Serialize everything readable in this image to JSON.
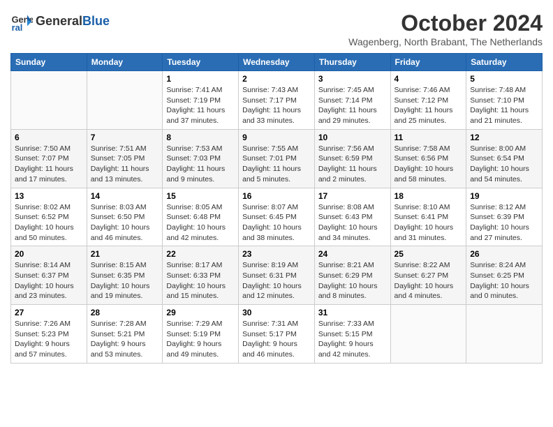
{
  "logo": {
    "line1": "General",
    "line2": "Blue"
  },
  "title": "October 2024",
  "location": "Wagenberg, North Brabant, The Netherlands",
  "weekdays": [
    "Sunday",
    "Monday",
    "Tuesday",
    "Wednesday",
    "Thursday",
    "Friday",
    "Saturday"
  ],
  "weeks": [
    [
      {
        "day": "",
        "info": ""
      },
      {
        "day": "",
        "info": ""
      },
      {
        "day": "1",
        "info": "Sunrise: 7:41 AM\nSunset: 7:19 PM\nDaylight: 11 hours and 37 minutes."
      },
      {
        "day": "2",
        "info": "Sunrise: 7:43 AM\nSunset: 7:17 PM\nDaylight: 11 hours and 33 minutes."
      },
      {
        "day": "3",
        "info": "Sunrise: 7:45 AM\nSunset: 7:14 PM\nDaylight: 11 hours and 29 minutes."
      },
      {
        "day": "4",
        "info": "Sunrise: 7:46 AM\nSunset: 7:12 PM\nDaylight: 11 hours and 25 minutes."
      },
      {
        "day": "5",
        "info": "Sunrise: 7:48 AM\nSunset: 7:10 PM\nDaylight: 11 hours and 21 minutes."
      }
    ],
    [
      {
        "day": "6",
        "info": "Sunrise: 7:50 AM\nSunset: 7:07 PM\nDaylight: 11 hours and 17 minutes."
      },
      {
        "day": "7",
        "info": "Sunrise: 7:51 AM\nSunset: 7:05 PM\nDaylight: 11 hours and 13 minutes."
      },
      {
        "day": "8",
        "info": "Sunrise: 7:53 AM\nSunset: 7:03 PM\nDaylight: 11 hours and 9 minutes."
      },
      {
        "day": "9",
        "info": "Sunrise: 7:55 AM\nSunset: 7:01 PM\nDaylight: 11 hours and 5 minutes."
      },
      {
        "day": "10",
        "info": "Sunrise: 7:56 AM\nSunset: 6:59 PM\nDaylight: 11 hours and 2 minutes."
      },
      {
        "day": "11",
        "info": "Sunrise: 7:58 AM\nSunset: 6:56 PM\nDaylight: 10 hours and 58 minutes."
      },
      {
        "day": "12",
        "info": "Sunrise: 8:00 AM\nSunset: 6:54 PM\nDaylight: 10 hours and 54 minutes."
      }
    ],
    [
      {
        "day": "13",
        "info": "Sunrise: 8:02 AM\nSunset: 6:52 PM\nDaylight: 10 hours and 50 minutes."
      },
      {
        "day": "14",
        "info": "Sunrise: 8:03 AM\nSunset: 6:50 PM\nDaylight: 10 hours and 46 minutes."
      },
      {
        "day": "15",
        "info": "Sunrise: 8:05 AM\nSunset: 6:48 PM\nDaylight: 10 hours and 42 minutes."
      },
      {
        "day": "16",
        "info": "Sunrise: 8:07 AM\nSunset: 6:45 PM\nDaylight: 10 hours and 38 minutes."
      },
      {
        "day": "17",
        "info": "Sunrise: 8:08 AM\nSunset: 6:43 PM\nDaylight: 10 hours and 34 minutes."
      },
      {
        "day": "18",
        "info": "Sunrise: 8:10 AM\nSunset: 6:41 PM\nDaylight: 10 hours and 31 minutes."
      },
      {
        "day": "19",
        "info": "Sunrise: 8:12 AM\nSunset: 6:39 PM\nDaylight: 10 hours and 27 minutes."
      }
    ],
    [
      {
        "day": "20",
        "info": "Sunrise: 8:14 AM\nSunset: 6:37 PM\nDaylight: 10 hours and 23 minutes."
      },
      {
        "day": "21",
        "info": "Sunrise: 8:15 AM\nSunset: 6:35 PM\nDaylight: 10 hours and 19 minutes."
      },
      {
        "day": "22",
        "info": "Sunrise: 8:17 AM\nSunset: 6:33 PM\nDaylight: 10 hours and 15 minutes."
      },
      {
        "day": "23",
        "info": "Sunrise: 8:19 AM\nSunset: 6:31 PM\nDaylight: 10 hours and 12 minutes."
      },
      {
        "day": "24",
        "info": "Sunrise: 8:21 AM\nSunset: 6:29 PM\nDaylight: 10 hours and 8 minutes."
      },
      {
        "day": "25",
        "info": "Sunrise: 8:22 AM\nSunset: 6:27 PM\nDaylight: 10 hours and 4 minutes."
      },
      {
        "day": "26",
        "info": "Sunrise: 8:24 AM\nSunset: 6:25 PM\nDaylight: 10 hours and 0 minutes."
      }
    ],
    [
      {
        "day": "27",
        "info": "Sunrise: 7:26 AM\nSunset: 5:23 PM\nDaylight: 9 hours and 57 minutes."
      },
      {
        "day": "28",
        "info": "Sunrise: 7:28 AM\nSunset: 5:21 PM\nDaylight: 9 hours and 53 minutes."
      },
      {
        "day": "29",
        "info": "Sunrise: 7:29 AM\nSunset: 5:19 PM\nDaylight: 9 hours and 49 minutes."
      },
      {
        "day": "30",
        "info": "Sunrise: 7:31 AM\nSunset: 5:17 PM\nDaylight: 9 hours and 46 minutes."
      },
      {
        "day": "31",
        "info": "Sunrise: 7:33 AM\nSunset: 5:15 PM\nDaylight: 9 hours and 42 minutes."
      },
      {
        "day": "",
        "info": ""
      },
      {
        "day": "",
        "info": ""
      }
    ]
  ]
}
